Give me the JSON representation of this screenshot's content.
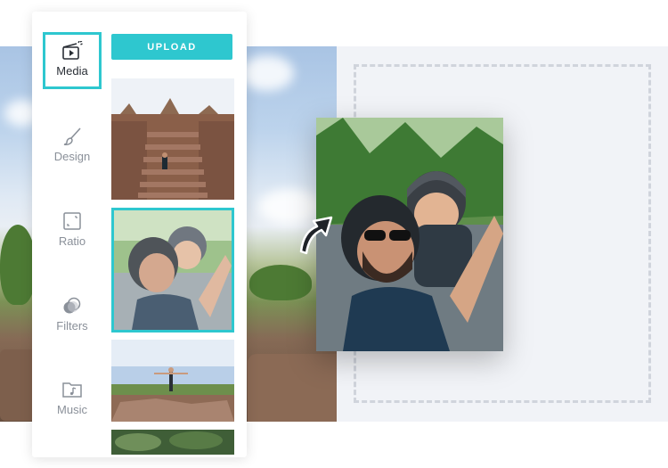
{
  "sidebar": {
    "items": [
      {
        "label": "Media",
        "icon": "media-icon",
        "active": true
      },
      {
        "label": "Design",
        "icon": "brush-icon",
        "active": false
      },
      {
        "label": "Ratio",
        "icon": "ratio-icon",
        "active": false
      },
      {
        "label": "Filters",
        "icon": "filters-icon",
        "active": false
      },
      {
        "label": "Music",
        "icon": "music-folder-icon",
        "active": false
      }
    ]
  },
  "media": {
    "upload_label": "UPLOAD",
    "thumbnails": [
      "temple-stairs-photo",
      "couple-selfie-photo",
      "rocks-landscape-photo",
      "green-foliage-photo"
    ],
    "selected_index": 1
  },
  "colors": {
    "accent": "#2ec7cf",
    "panel": "#ffffff",
    "canvas": "#f1f3f7",
    "drop_border": "#d0d4dc"
  }
}
